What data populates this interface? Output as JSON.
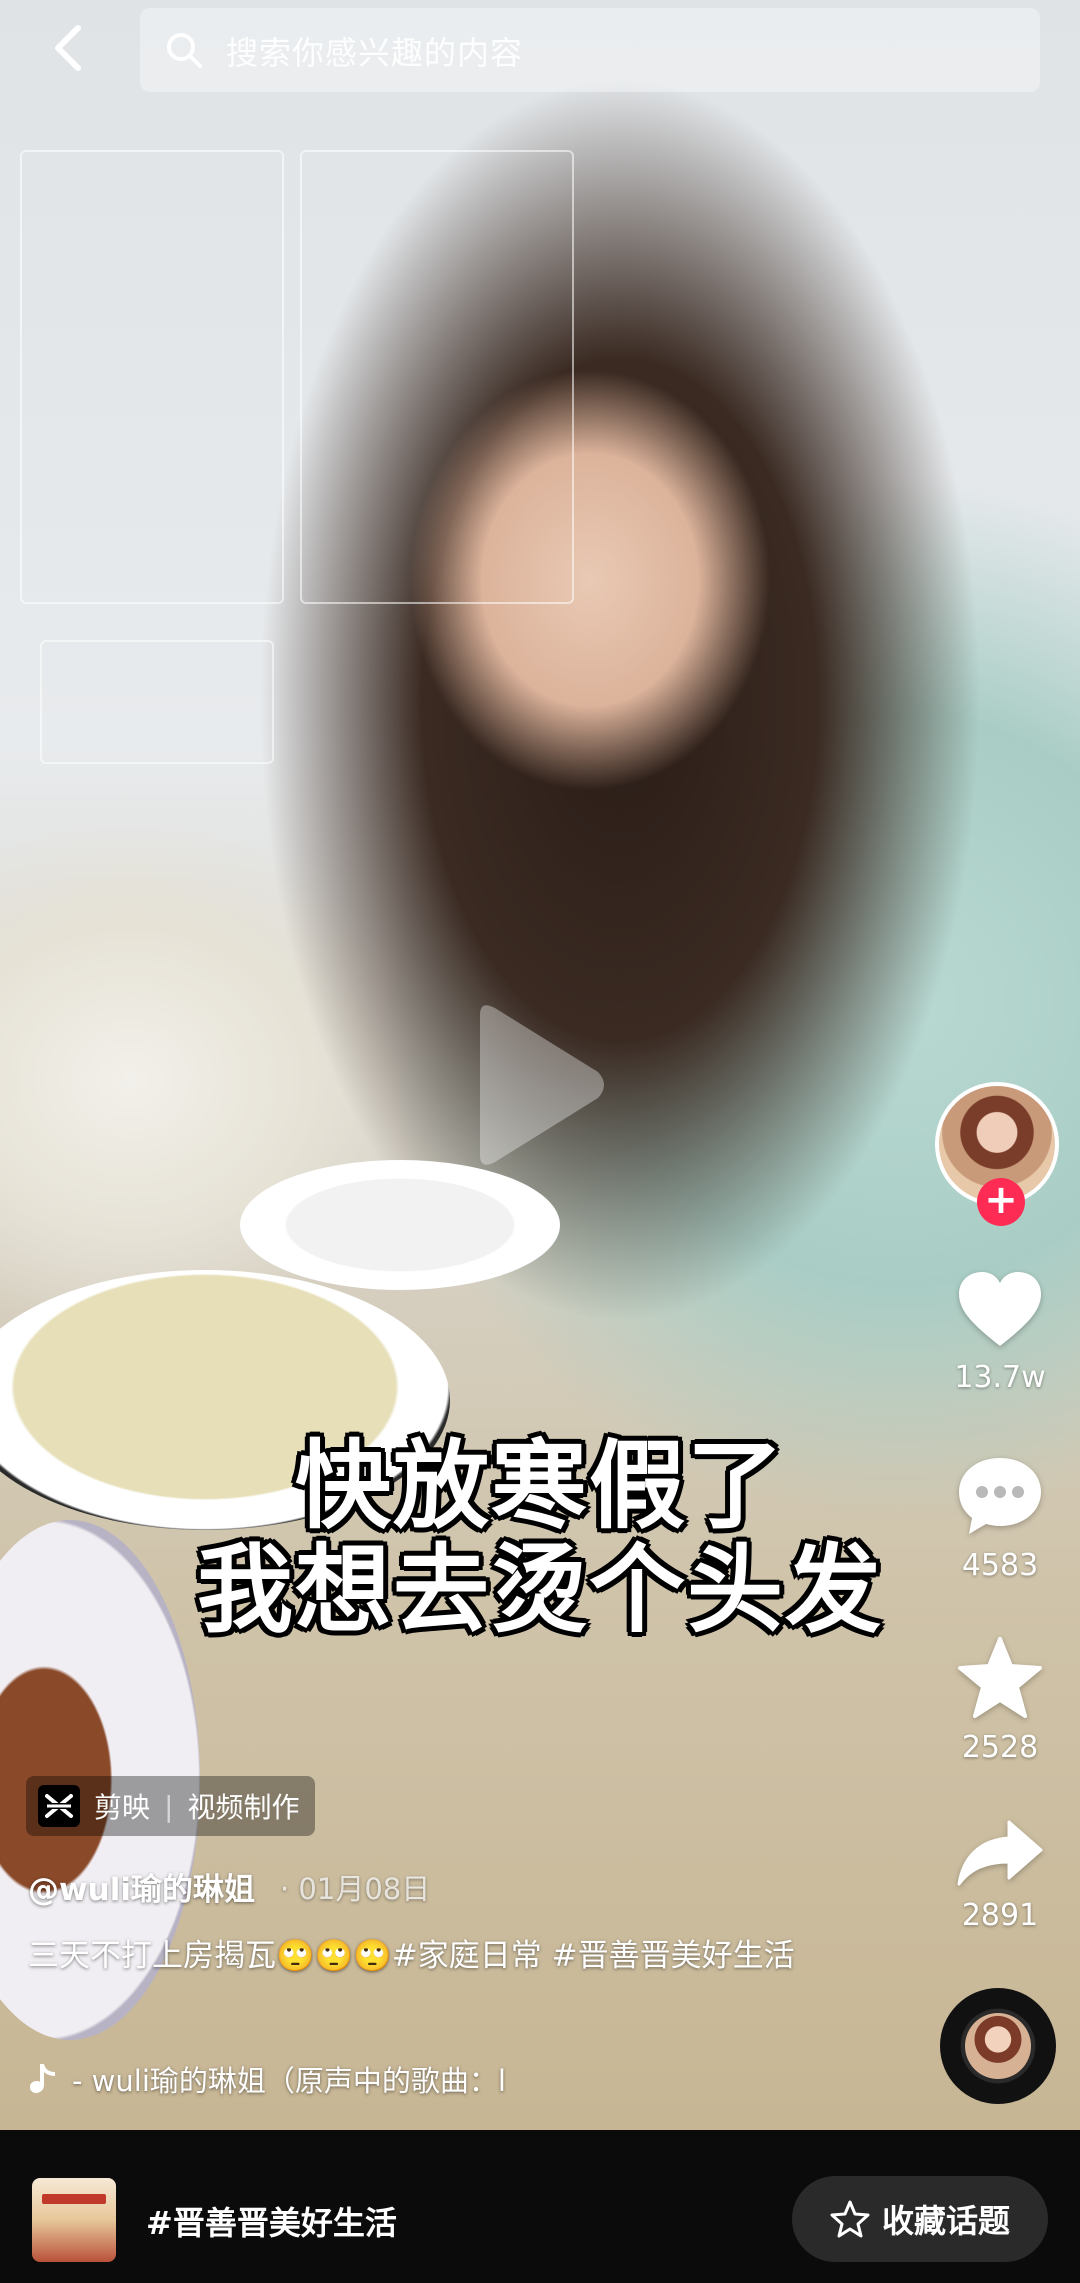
{
  "search": {
    "placeholder": "搜索你感兴趣的内容"
  },
  "subtitle": {
    "line1": "快放寒假了",
    "line2": "我想去烫个头发"
  },
  "actions": {
    "like_count": "13.7w",
    "comment_count": "4583",
    "favorite_count": "2528",
    "share_count": "2891"
  },
  "follow": {
    "plus": "+"
  },
  "capcut": {
    "app": "剪映",
    "divider": "|",
    "label": "视频制作"
  },
  "post": {
    "author": "@wuli瑜的琳姐",
    "date": "· 01月08日",
    "caption": "三天不打上房揭瓦🙄🙄🙄#家庭日常 #晋善晋美好生活",
    "music": "- wuli瑜的琳姐（原声中的歌曲：l"
  },
  "bottom": {
    "topic": "#晋善晋美好生活",
    "favorite_topic": "收藏话题"
  },
  "colors": {
    "accent": "#fe2c55",
    "bar": "#0b0b0b"
  },
  "icons": [
    "back-icon",
    "search-icon",
    "play-icon",
    "heart-icon",
    "comment-icon",
    "star-icon",
    "share-icon",
    "tiktok-note-icon",
    "capcut-icon",
    "star-outline-icon"
  ]
}
